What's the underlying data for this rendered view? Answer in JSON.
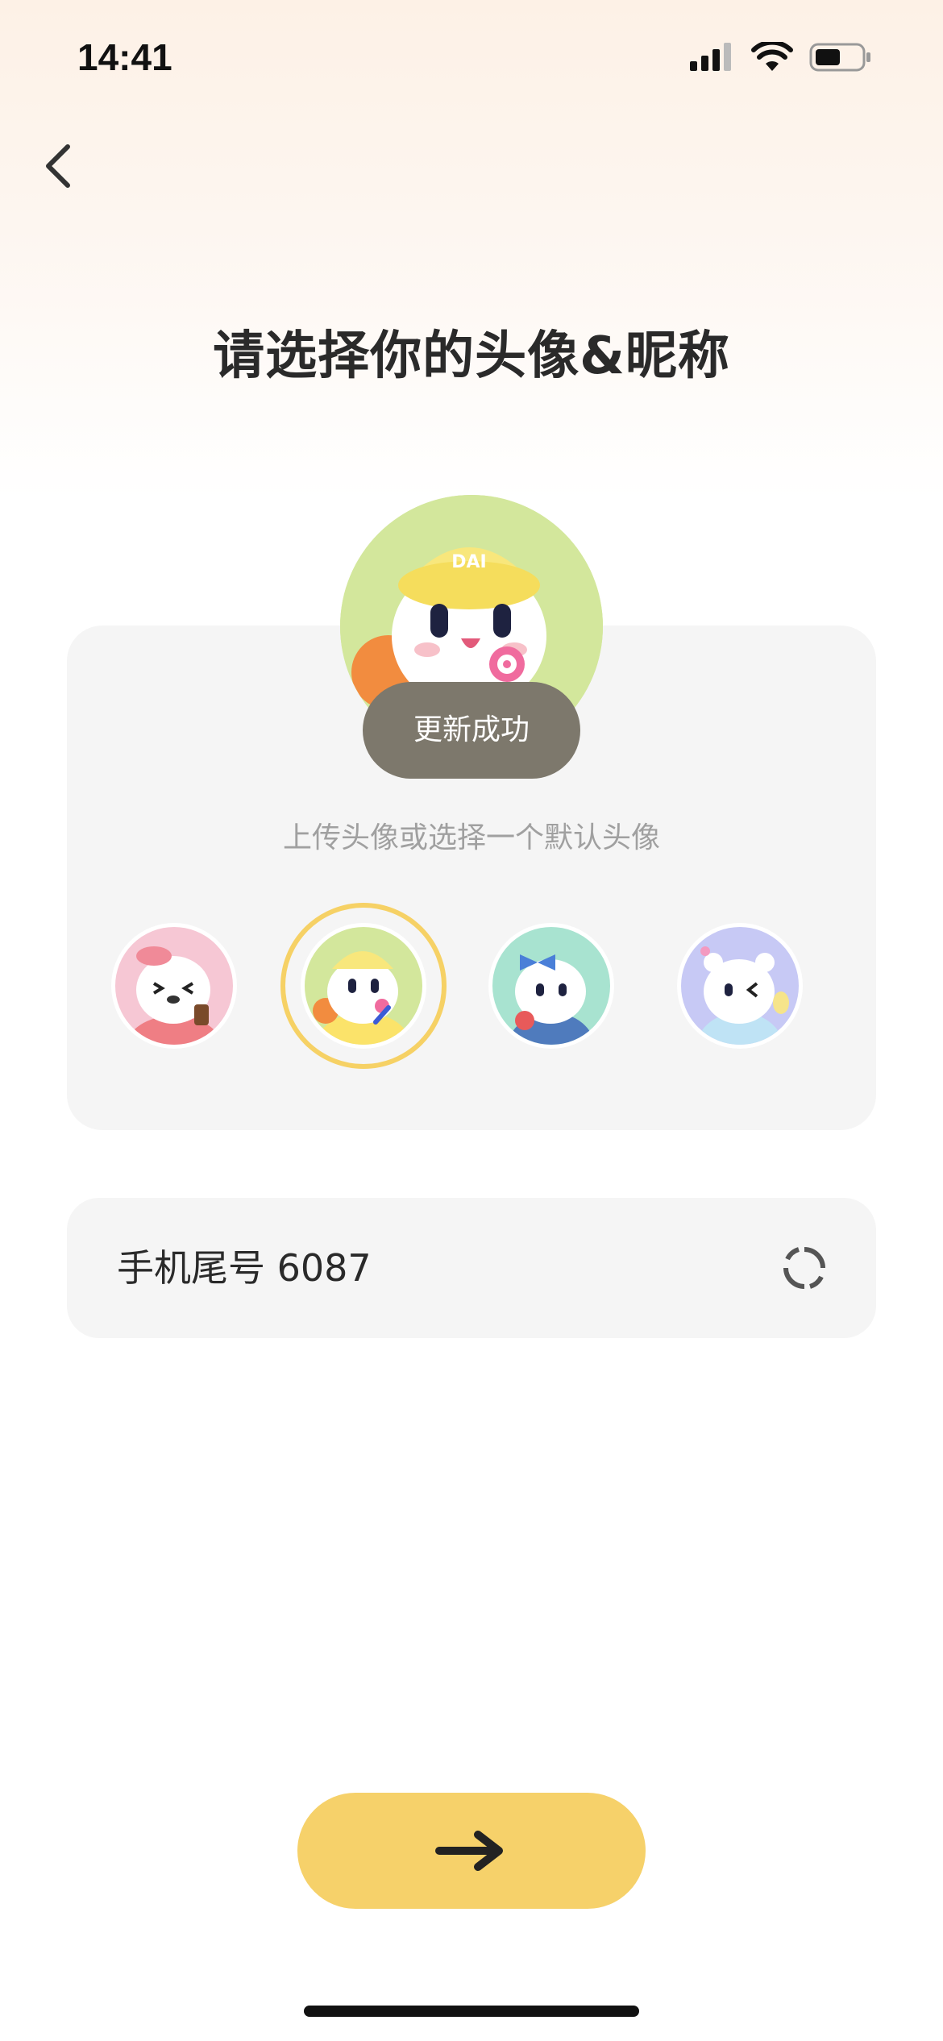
{
  "status_bar": {
    "time": "14:41"
  },
  "title": "请选择你的头像&昵称",
  "avatar_card": {
    "toast": "更新成功",
    "hint": "上传头像或选择一个默认头像",
    "options": [
      {
        "name": "pink-bear",
        "bg": "#f6c7d4"
      },
      {
        "name": "yellow-hat-bear",
        "bg": "#d3e79c",
        "selected": true
      },
      {
        "name": "blue-bow-bear",
        "bg": "#a8e3d0"
      },
      {
        "name": "purple-bear",
        "bg": "#c7c9f5"
      }
    ],
    "hat_text": "DAI"
  },
  "nickname": {
    "value": "手机尾号 6087"
  },
  "colors": {
    "accent": "#f6d16a",
    "card": "#f5f5f5",
    "toast": "#7d786c"
  }
}
